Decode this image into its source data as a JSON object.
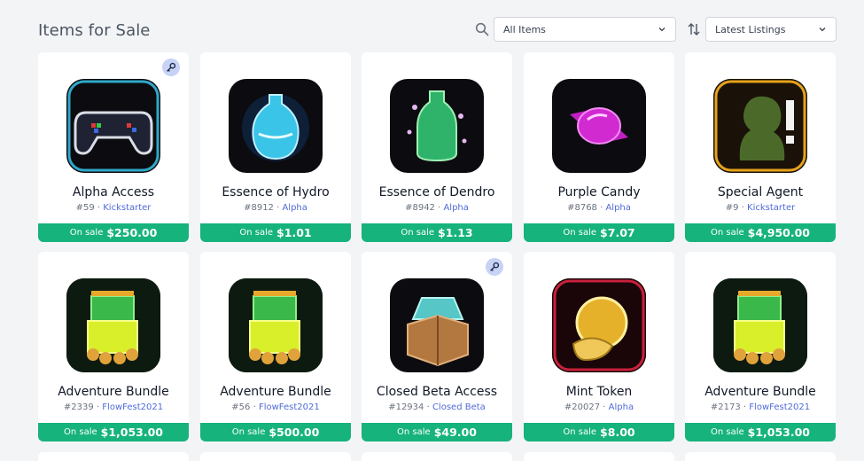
{
  "page": {
    "title": "Items for Sale"
  },
  "filters": {
    "category": {
      "selected": "All Items",
      "icon": "search-icon"
    },
    "sort": {
      "selected": "Latest Listings",
      "icon": "sort-arrows-icon"
    }
  },
  "colors": {
    "accent": "#16b37c",
    "collection_link": "#4f6bd8",
    "key_badge": "#c7d2f7"
  },
  "sale_label": "On sale",
  "items": [
    {
      "name": "Alpha Access",
      "id": "#59",
      "collection": "Kickstarter",
      "price": "$250.00",
      "has_key": true,
      "art": "gamepad"
    },
    {
      "name": "Essence of Hydro",
      "id": "#8912",
      "collection": "Alpha",
      "price": "$1.01",
      "has_key": false,
      "art": "hydro"
    },
    {
      "name": "Essence of Dendro",
      "id": "#8942",
      "collection": "Alpha",
      "price": "$1.13",
      "has_key": false,
      "art": "dendro"
    },
    {
      "name": "Purple Candy",
      "id": "#8768",
      "collection": "Alpha",
      "price": "$7.07",
      "has_key": false,
      "art": "candy"
    },
    {
      "name": "Special Agent",
      "id": "#9",
      "collection": "Kickstarter",
      "price": "$4,950.00",
      "has_key": false,
      "art": "agent"
    },
    {
      "name": "Adventure Bundle",
      "id": "#2339",
      "collection": "FlowFest2021",
      "price": "$1,053.00",
      "has_key": false,
      "art": "bundle"
    },
    {
      "name": "Adventure Bundle",
      "id": "#56",
      "collection": "FlowFest2021",
      "price": "$500.00",
      "has_key": false,
      "art": "bundle"
    },
    {
      "name": "Closed Beta Access",
      "id": "#12934",
      "collection": "Closed Beta",
      "price": "$49.00",
      "has_key": true,
      "art": "beta"
    },
    {
      "name": "Mint Token",
      "id": "#20027",
      "collection": "Alpha",
      "price": "$8.00",
      "has_key": false,
      "art": "coin"
    },
    {
      "name": "Adventure Bundle",
      "id": "#2173",
      "collection": "FlowFest2021",
      "price": "$1,053.00",
      "has_key": false,
      "art": "bundle"
    }
  ]
}
